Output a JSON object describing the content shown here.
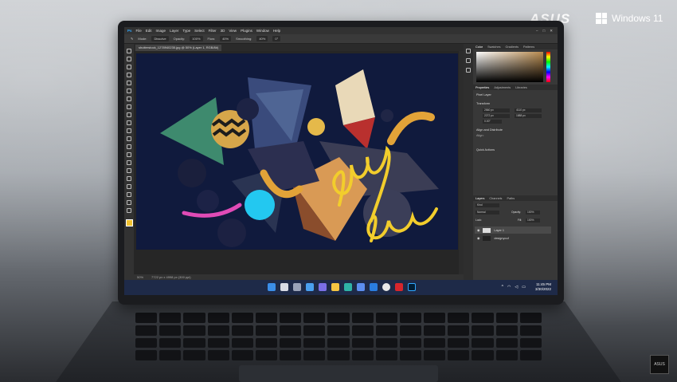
{
  "branding": {
    "asus": "ASUS",
    "windows": "Windows 11",
    "corner_badge": "ASUS"
  },
  "photoshop": {
    "app_icon": "Ps",
    "menus": [
      "File",
      "Edit",
      "Image",
      "Layer",
      "Type",
      "Select",
      "Filter",
      "3D",
      "View",
      "Plugins",
      "Window",
      "Help"
    ],
    "window_controls": [
      "minimize-icon",
      "maximize-icon",
      "close-icon"
    ],
    "options_bar": {
      "mode_label": "Mode:",
      "mode_value": "Dissolve",
      "opacity_label": "Opacity:",
      "opacity_value": "100%",
      "flow_label": "Flow:",
      "flow_value": "40%",
      "smoothing_label": "Smoothing:",
      "smoothing_value": "40%",
      "angle_value": "0°"
    },
    "document_tab": "shutterstock_1278940235.jpg @ 50% (Layer 1, RGB/8#)",
    "status_bar": {
      "zoom": "50%",
      "dimensions": "7722 px x 4998 px (300 ppi)"
    },
    "color_panel_tabs": [
      "Color",
      "Swatches",
      "Gradients",
      "Patterns"
    ],
    "properties_tabs": [
      "Properties",
      "Adjustments",
      "Libraries"
    ],
    "properties": {
      "layer_type": "Pixel Layer",
      "transform_label": "Transform",
      "w": "2560 px",
      "x": "4110 px",
      "h": "2272 px",
      "y": "1888 px",
      "angle": "0.00°",
      "align_label": "Align and Distribute",
      "align_sub": "Align:",
      "quick_actions": "Quick Actions"
    },
    "layers_tabs": [
      "Layers",
      "Channels",
      "Paths"
    ],
    "layers": {
      "kind": "Kind",
      "blend": "Normal",
      "opacity_label": "Opacity:",
      "opacity_value": "100%",
      "lock_label": "Lock:",
      "fill_label": "Fill:",
      "fill_value": "100%",
      "items": [
        {
          "name": "Layer 1",
          "selected": true
        },
        {
          "name": "designyouf",
          "selected": false
        }
      ]
    }
  },
  "taskbar": {
    "time": "11:45 PM",
    "date": "3/30/2022",
    "icons": [
      "start-icon",
      "search-icon",
      "task-view-icon",
      "widgets-icon",
      "chat-icon",
      "file-explorer-icon",
      "edge-icon",
      "store-icon",
      "mail-icon",
      "cortana-icon",
      "mcafee-icon",
      "photoshop-icon"
    ],
    "colors": {
      "accent": "#31a8ff"
    }
  }
}
